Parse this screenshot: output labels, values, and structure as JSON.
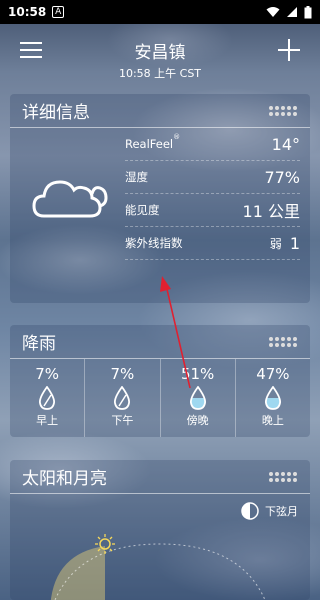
{
  "status_bar": {
    "time": "10:58",
    "notif_letter": "A"
  },
  "header": {
    "city": "安昌镇",
    "local_time": "10:58 上午 CST"
  },
  "details": {
    "title": "详细信息",
    "rows": [
      {
        "label": "RealFeel",
        "sup": "®",
        "value": "14°"
      },
      {
        "label": "湿度",
        "value": "77%"
      },
      {
        "label": "能见度",
        "value": "11 公里"
      }
    ],
    "uv": {
      "label": "紫外线指数",
      "level": "弱",
      "value": "1"
    }
  },
  "precipitation": {
    "title": "降雨",
    "items": [
      {
        "pct": "7%",
        "label": "早上",
        "fill": 0.0
      },
      {
        "pct": "7%",
        "label": "下午",
        "fill": 0.0
      },
      {
        "pct": "51%",
        "label": "傍晚",
        "fill": 0.5
      },
      {
        "pct": "47%",
        "label": "晚上",
        "fill": 0.5
      }
    ]
  },
  "sun_moon": {
    "title": "太阳和月亮",
    "moon_phase": "下弦月"
  },
  "colors": {
    "annotation_arrow": "#e02030",
    "drop_fill": "#9fd8f0"
  }
}
